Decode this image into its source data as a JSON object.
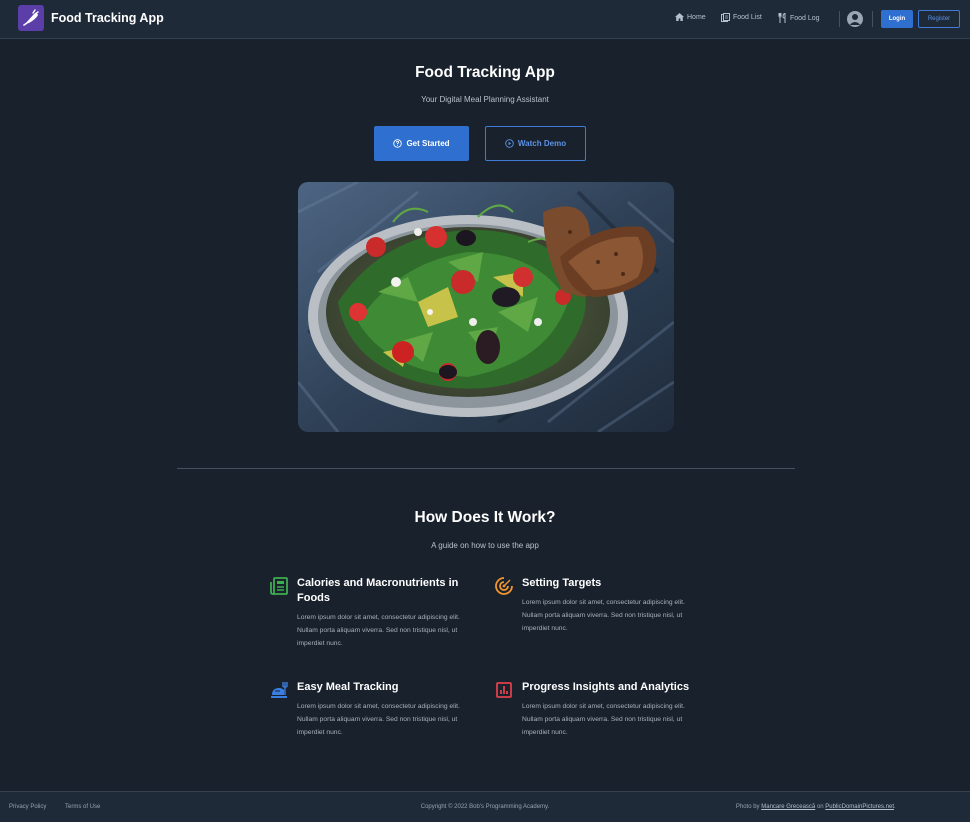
{
  "navbar": {
    "brand_title": "Food Tracking App",
    "links": [
      {
        "label": "Home",
        "icon": "home-icon"
      },
      {
        "label": "Food List",
        "icon": "list-icon"
      },
      {
        "label": "Food Log",
        "icon": "utensils-icon"
      }
    ],
    "login_label": "Login",
    "register_label": "Register"
  },
  "hero": {
    "title": "Food Tracking App",
    "subtitle": "Your Digital Meal Planning Assistant",
    "primary_button": "Get Started",
    "secondary_button": "Watch Demo"
  },
  "features": {
    "title": "How Does It Work?",
    "subtitle": "A guide on how to use the app",
    "items": [
      {
        "title": "Calories and Macronutrients in Foods",
        "text": "Lorem ipsum dolor sit amet, consectetur adipiscing elit. Nullam porta aliquam viverra. Sed non tristique nisl, ut imperdiet nunc.",
        "icon": "newspaper-icon",
        "color": "#3cae4f"
      },
      {
        "title": "Setting Targets",
        "text": "Lorem ipsum dolor sit amet, consectetur adipiscing elit. Nullam porta aliquam viverra. Sed non tristique nisl, ut imperdiet nunc.",
        "icon": "target-icon",
        "color": "#f0962e"
      },
      {
        "title": "Easy Meal Tracking",
        "text": "Lorem ipsum dolor sit amet, consectetur adipiscing elit. Nullam porta aliquam viverra. Sed non tristique nisl, ut imperdiet nunc.",
        "icon": "food-plate-icon",
        "color": "#3a7ee0"
      },
      {
        "title": "Progress Insights and Analytics",
        "text": "Lorem ipsum dolor sit amet, consectetur adipiscing elit. Nullam porta aliquam viverra. Sed non tristique nisl, ut imperdiet nunc.",
        "icon": "analytics-icon",
        "color": "#e0404a"
      }
    ]
  },
  "footer": {
    "privacy": "Privacy Policy",
    "terms": "Terms of Use",
    "copyright": "Copyright © 2022 Bob's Programming Academy.",
    "credit_prefix": "Photo by",
    "credit_author": "Mancare Grecească",
    "credit_on": "on",
    "credit_site": "PublicDomainPictures.net",
    "credit_suffix": "."
  },
  "colors": {
    "background": "#19212c",
    "navbar": "#1f2a38",
    "accent": "#2f6fcf",
    "brand_logo": "#5b3ea8"
  }
}
